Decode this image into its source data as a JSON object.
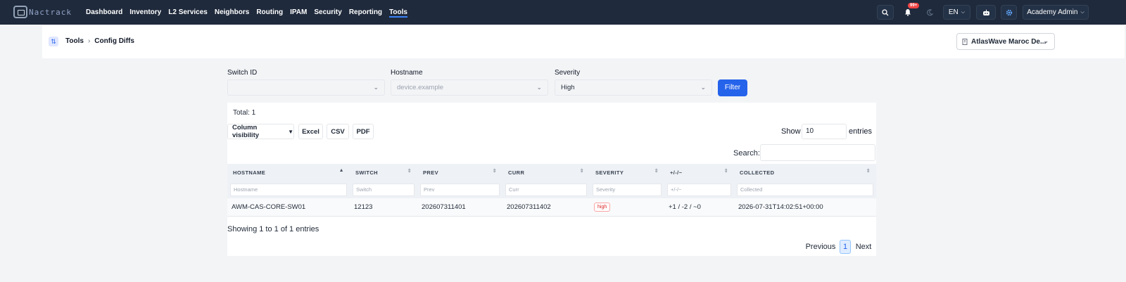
{
  "app": {
    "logo_text": "Nactrack"
  },
  "nav": {
    "items": [
      "Dashboard",
      "Inventory",
      "L2 Services",
      "Neighbors",
      "Routing",
      "IPAM",
      "Security",
      "Reporting",
      "Tools"
    ],
    "active": "Tools"
  },
  "topbar": {
    "notification_count": "99+",
    "language": "EN",
    "user": "Academy Admin"
  },
  "breadcrumb": {
    "section": "Tools",
    "page": "Config Diffs"
  },
  "site_selector": {
    "value": "AtlasWave Maroc De..."
  },
  "filters": {
    "switch_id": {
      "label": "Switch ID",
      "value": ""
    },
    "hostname": {
      "label": "Hostname",
      "placeholder": "device.example"
    },
    "severity": {
      "label": "Severity",
      "value": "High"
    },
    "submit_label": "Filter"
  },
  "table_tools": {
    "total": "Total: 1",
    "column_visibility": "Column visibility",
    "excel": "Excel",
    "csv": "CSV",
    "pdf": "PDF",
    "show_label": "Show",
    "show_value": "10",
    "entries_label": "entries",
    "search_label": "Search:"
  },
  "table": {
    "columns": [
      "HOSTNAME",
      "SWITCH",
      "PREV",
      "CURR",
      "SEVERITY",
      "+/-/~",
      "COLLECTED"
    ],
    "filter_placeholders": [
      "Hostname",
      "Switch",
      "Prev",
      "Curr",
      "Severity",
      "+/-/~",
      "Collected"
    ],
    "rows": [
      {
        "hostname": "AWM-CAS-CORE-SW01",
        "switch": "12123",
        "prev": "202607311401",
        "curr": "202607311402",
        "severity": "high",
        "delta": "+1 / -2 / ~0",
        "collected": "2026-07-31T14:02:51+00:00"
      }
    ]
  },
  "footer": {
    "showing": "Showing 1 to 1 of 1 entries",
    "previous": "Previous",
    "page": "1",
    "next": "Next"
  },
  "colors": {
    "nav_bg": "#1f2a3c",
    "accent": "#2563eb",
    "severity_high": "#dc2626"
  }
}
